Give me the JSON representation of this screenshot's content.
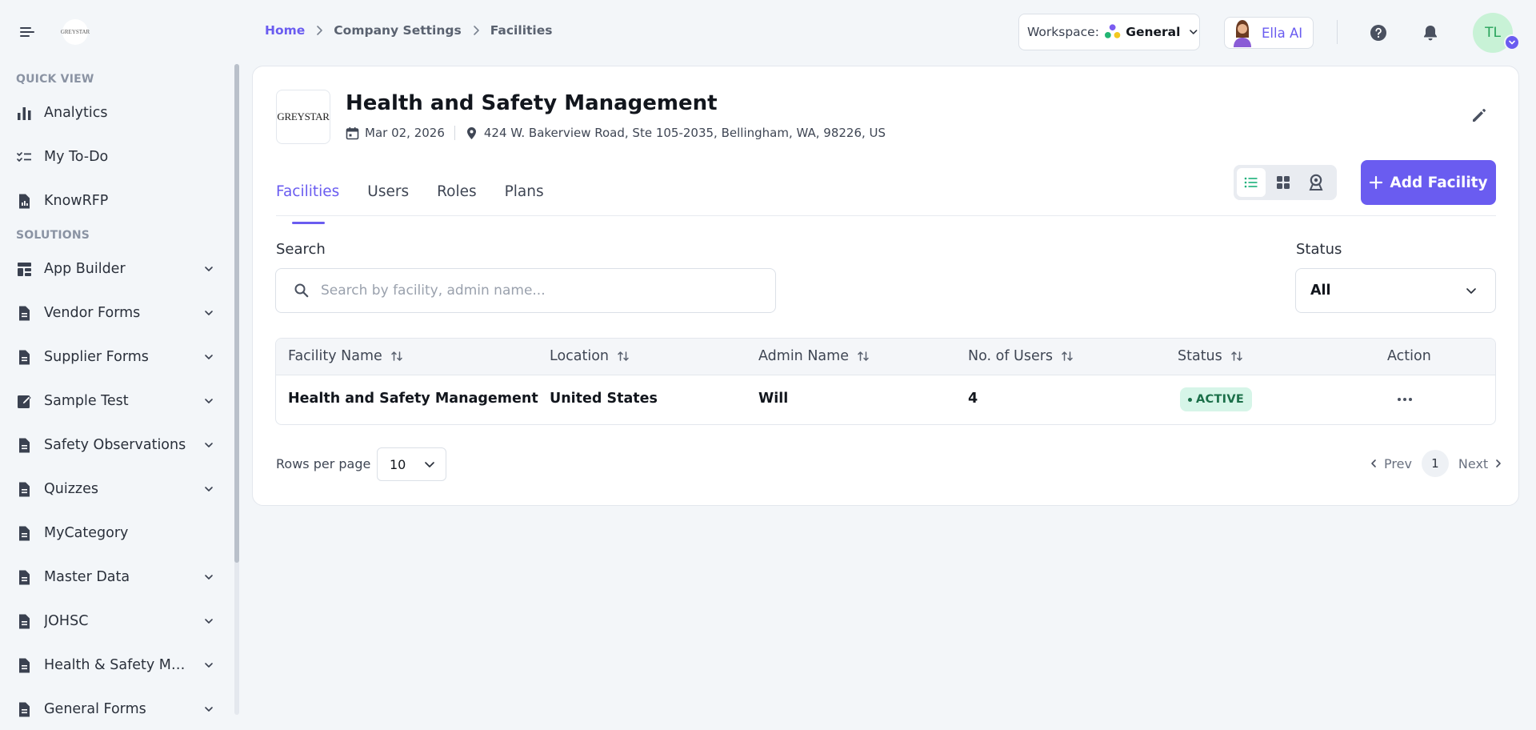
{
  "topbar": {
    "logo_text": "GREYSTAR",
    "breadcrumb": [
      "Home",
      "Company Settings",
      "Facilities"
    ],
    "workspace": {
      "label": "Workspace:",
      "value": "General"
    },
    "assistant": {
      "name": "Ella AI"
    },
    "user": {
      "initials": "TL"
    }
  },
  "sidebar": {
    "quick_view_label": "QUICK VIEW",
    "quick_view": [
      {
        "label": "Analytics",
        "icon": "bar-chart-icon"
      },
      {
        "label": "My To-Do",
        "icon": "checklist-icon"
      },
      {
        "label": "KnowRFP",
        "icon": "document-chart-icon"
      }
    ],
    "solutions_label": "SOLUTIONS",
    "solutions": [
      {
        "label": "App Builder",
        "icon": "layout-icon",
        "expandable": true
      },
      {
        "label": "Vendor Forms",
        "icon": "document-icon",
        "expandable": true
      },
      {
        "label": "Supplier Forms",
        "icon": "document-icon",
        "expandable": true
      },
      {
        "label": "Sample Test",
        "icon": "edit-square-icon",
        "expandable": true
      },
      {
        "label": "Safety Observations",
        "icon": "document-icon",
        "expandable": true
      },
      {
        "label": "Quizzes",
        "icon": "document-icon",
        "expandable": true
      },
      {
        "label": "MyCategory",
        "icon": "document-icon",
        "expandable": false
      },
      {
        "label": "Master Data",
        "icon": "document-icon",
        "expandable": true
      },
      {
        "label": "JOHSC",
        "icon": "document-icon",
        "expandable": true
      },
      {
        "label": "Health & Safety Mgmt",
        "icon": "document-icon",
        "expandable": true
      },
      {
        "label": "General Forms",
        "icon": "document-icon",
        "expandable": true
      }
    ]
  },
  "org": {
    "logo_text": "GREYSTAR",
    "title": "Health and Safety Management",
    "date": "Mar 02, 2026",
    "address": "424 W. Bakerview Road, Ste 105-2035, Bellingham, WA, 98226, US"
  },
  "tabs": [
    "Facilities",
    "Users",
    "Roles",
    "Plans"
  ],
  "active_tab": "Facilities",
  "add_button_label": "Add Facility",
  "search": {
    "label": "Search",
    "placeholder": "Search by facility, admin name...",
    "value": ""
  },
  "status_filter": {
    "label": "Status",
    "value": "All"
  },
  "table": {
    "columns": [
      "Facility Name",
      "Location",
      "Admin Name",
      "No. of Users",
      "Status",
      "Action"
    ],
    "rows": [
      {
        "facility": "Health and Safety Management",
        "location": "United States",
        "admin": "Will",
        "users": "4",
        "status": "ACTIVE"
      }
    ]
  },
  "pagination": {
    "rows_label": "Rows per page",
    "rows_value": "10",
    "prev": "Prev",
    "page": "1",
    "next": "Next"
  },
  "colors": {
    "accent": "#6a5cf0",
    "active_badge_bg": "#d6f5e8",
    "active_badge_text": "#1b6f49"
  }
}
